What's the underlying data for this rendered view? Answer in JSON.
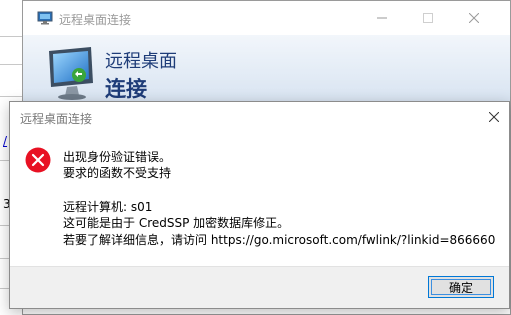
{
  "background": {
    "left_chars": [
      "3"
    ],
    "left_link": "/"
  },
  "main_window": {
    "title": "远程桌面连接",
    "banner_line1": "远程桌面",
    "banner_line2": "连接",
    "icon": "remote-desktop-icon"
  },
  "dialog": {
    "title": "远程桌面连接",
    "icon": "error-icon",
    "lines": [
      "出现身份验证错误。",
      "要求的函数不受支持",
      "远程计算机: s01",
      "这可能是由于 CredSSP 加密数据库修正。",
      "若要了解详细信息，请访问 https://go.microsoft.com/fwlink/?linkid=866660"
    ],
    "ok_label": "确定"
  },
  "colors": {
    "banner_text": "#1e3c78",
    "error_red": "#e81123",
    "button_border": "#0078d7"
  }
}
